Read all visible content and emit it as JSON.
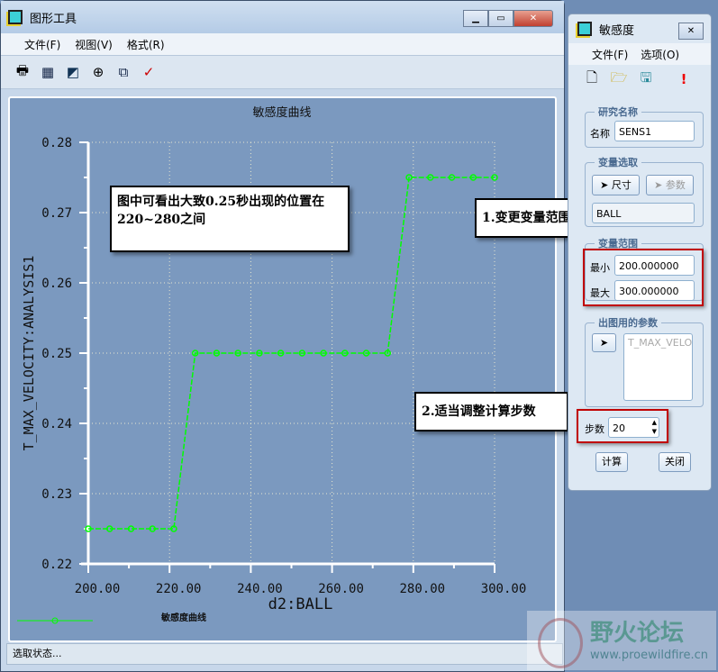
{
  "main_window": {
    "title": "图形工具",
    "menu": [
      "文件(F)",
      "视图(V)",
      "格式(R)"
    ],
    "toolbar_icons": [
      "print-icon",
      "grid-icon",
      "edit-icon",
      "zoom-in-icon",
      "zoom-window-icon",
      "format-icon"
    ],
    "status": "选取状态..."
  },
  "annotations": {
    "note1": "图中可看出大致0.25秒出现的位置在220~280之间",
    "step1": "1.变更变量范围",
    "step2": "2.适当调整计算步数"
  },
  "panel": {
    "title": "敏感度",
    "menu": [
      "文件(F)",
      "选项(O)"
    ],
    "study_group": "研究名称",
    "name_label": "名称",
    "name_value": "SENS1",
    "var_group": "变量选取",
    "dim_btn": "尺寸",
    "param_btn": "参数",
    "var_value": "BALL",
    "range_group": "变量范围",
    "min_label": "最小",
    "min_value": "200.000000",
    "max_label": "最大",
    "max_value": "300.000000",
    "plot_group": "出图用的参数",
    "plot_param": "T_MAX_VELO",
    "steps_label": "步数",
    "steps_value": "20",
    "compute_btn": "计算",
    "close_btn": "关闭"
  },
  "watermark": {
    "name": "野火论坛",
    "url": "www.proewildfire.cn"
  },
  "chart_data": {
    "type": "line",
    "title": "敏感度曲线",
    "xlabel": "d2:BALL",
    "ylabel": "T_MAX_VELOCITY:ANALYSIS1",
    "xlim": [
      200,
      300
    ],
    "ylim": [
      0.22,
      0.28
    ],
    "xticks": [
      "200.00",
      "220.00",
      "240.00",
      "260.00",
      "280.00",
      "300.00"
    ],
    "yticks": [
      "0.22",
      "0.23",
      "0.24",
      "0.25",
      "0.26",
      "0.27",
      "0.28"
    ],
    "legend": "敏感度曲线",
    "color": "#00ff00",
    "x": [
      200,
      205.26,
      210.53,
      215.79,
      221.05,
      226.32,
      231.58,
      236.84,
      242.11,
      247.37,
      252.63,
      257.89,
      263.16,
      268.42,
      273.68,
      278.95,
      284.21,
      289.47,
      294.74,
      300
    ],
    "y": [
      0.225,
      0.225,
      0.225,
      0.225,
      0.225,
      0.25,
      0.25,
      0.25,
      0.25,
      0.25,
      0.25,
      0.25,
      0.25,
      0.25,
      0.25,
      0.275,
      0.275,
      0.275,
      0.275,
      0.275
    ]
  }
}
